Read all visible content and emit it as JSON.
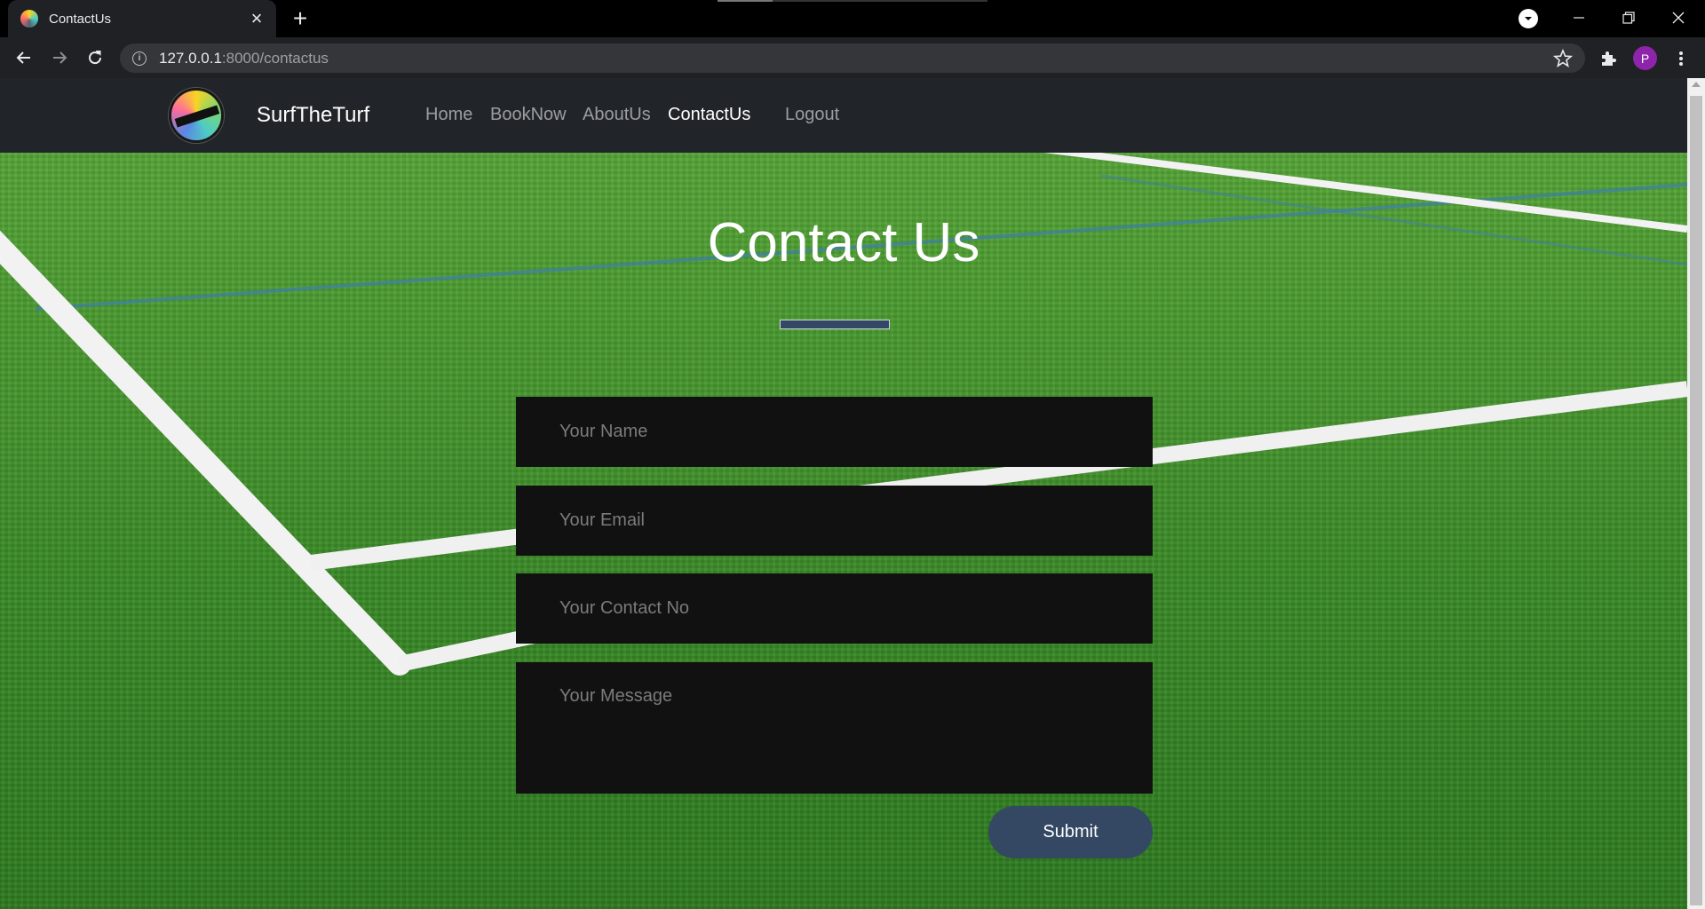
{
  "browser": {
    "tab_title": "ContactUs",
    "url_host": "127.0.0.1",
    "url_path": ":8000/contactus",
    "profile_initial": "P"
  },
  "site": {
    "brand": "SurfTheTurf",
    "nav": [
      {
        "label": "Home",
        "active": false
      },
      {
        "label": "BookNow",
        "active": false
      },
      {
        "label": "AboutUs",
        "active": false
      },
      {
        "label": "ContactUs",
        "active": true
      },
      {
        "label": "Logout",
        "active": false
      }
    ]
  },
  "contact": {
    "heading": "Contact Us",
    "name_placeholder": "Your Name",
    "email_placeholder": "Your Email",
    "phone_placeholder": "Your Contact No",
    "message_placeholder": "Your Message",
    "submit_label": "Submit"
  },
  "colors": {
    "navbar_bg": "#212529",
    "accent": "#344763",
    "input_bg": "#111112"
  }
}
